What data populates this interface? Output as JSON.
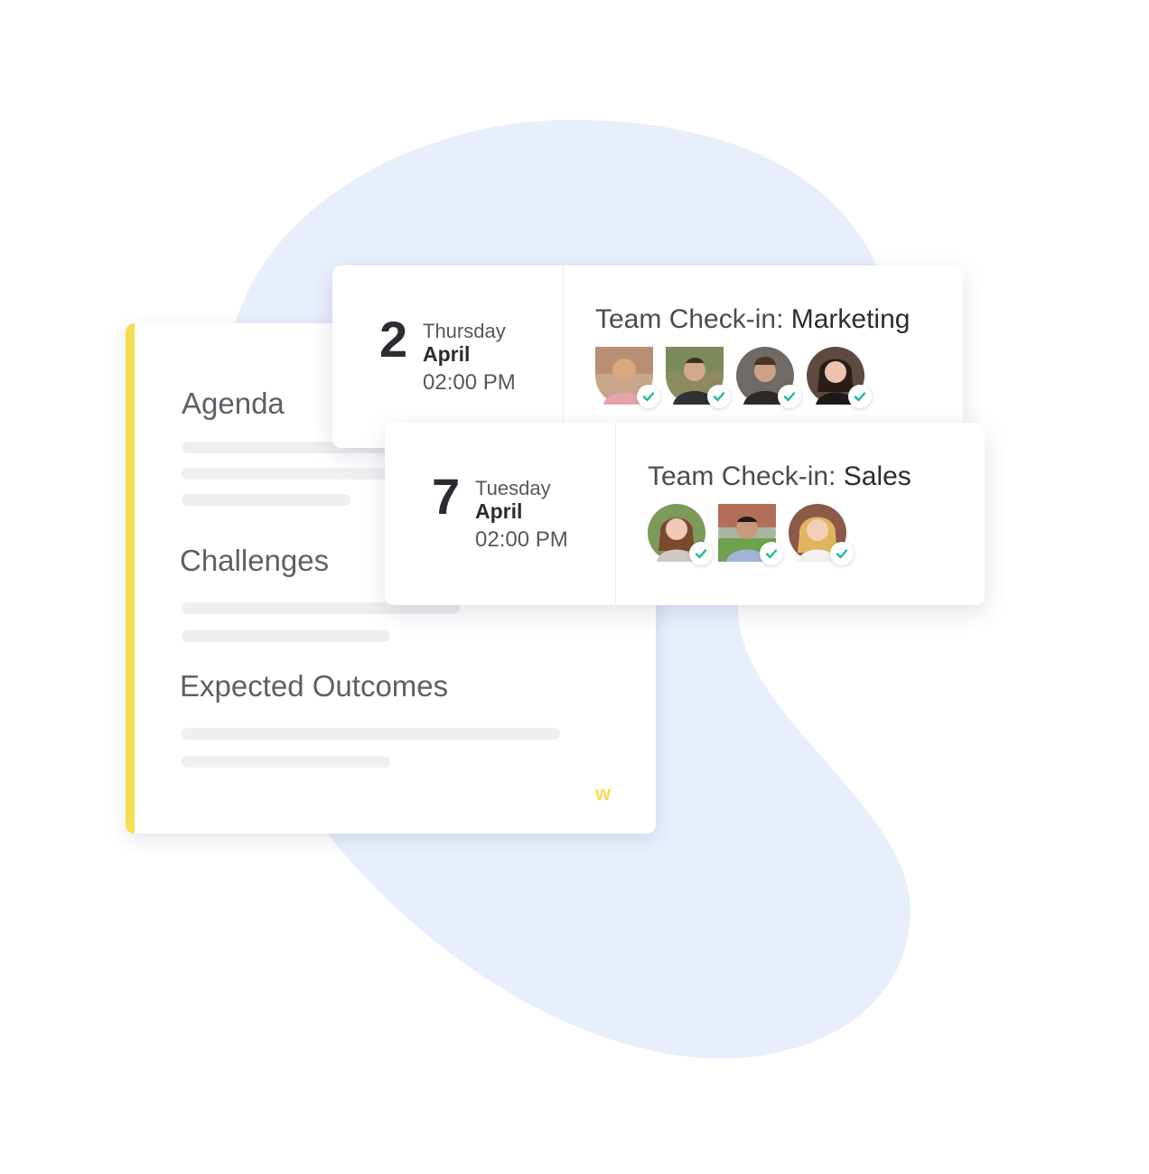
{
  "theme": {
    "blob_color": "#e8eefc",
    "accent_color": "#f6dc4f",
    "check_color": "#1fb99a"
  },
  "agenda": {
    "sections": [
      {
        "heading": "Agenda"
      },
      {
        "heading": "Challenges"
      },
      {
        "heading": "Expected Outcomes"
      }
    ],
    "logo_icon": "w"
  },
  "meetings": [
    {
      "day": "2",
      "weekday": "Thursday",
      "month": "April",
      "time": "02:00 PM",
      "title_prefix": "Team Check-in: ",
      "team": "Marketing",
      "attendees": [
        {
          "name": "attendee-1",
          "status_icon": "check-icon"
        },
        {
          "name": "attendee-2",
          "status_icon": "check-icon"
        },
        {
          "name": "attendee-3",
          "status_icon": "check-icon"
        },
        {
          "name": "attendee-4",
          "status_icon": "check-icon"
        }
      ]
    },
    {
      "day": "7",
      "weekday": "Tuesday",
      "month": "April",
      "time": "02:00 PM",
      "title_prefix": "Team Check-in: ",
      "team": "Sales",
      "attendees": [
        {
          "name": "attendee-1",
          "status_icon": "check-icon"
        },
        {
          "name": "attendee-2",
          "status_icon": "check-icon"
        },
        {
          "name": "attendee-3",
          "status_icon": "check-icon"
        }
      ]
    }
  ]
}
